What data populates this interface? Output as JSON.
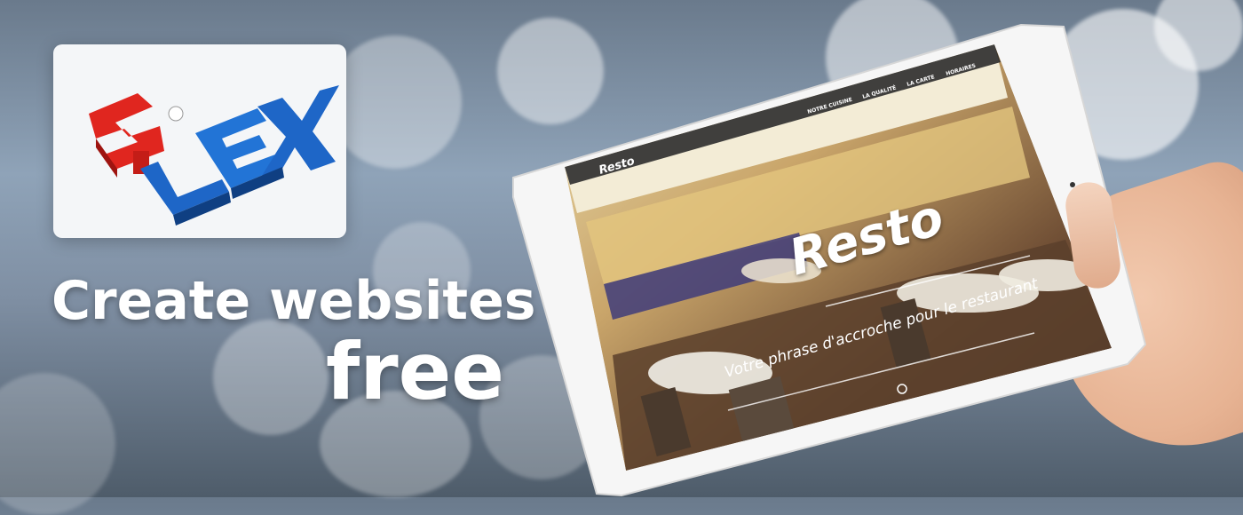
{
  "logo": {
    "word": "SiLEX"
  },
  "headline": {
    "line1": "Create websites",
    "line2": "free"
  },
  "tablet": {
    "site": {
      "brand": "Resto",
      "nav": [
        "NOTRE CUISINE",
        "LA QUALITÉ",
        "LA CARTE",
        "HORAIRES"
      ],
      "hero_title": "Resto",
      "tagline": "Votre phrase d'accroche pour le restaurant"
    }
  },
  "colors": {
    "logo_red": "#e0261f",
    "logo_blue": "#1e66c7",
    "nav_bar": "#2c2c2c"
  }
}
